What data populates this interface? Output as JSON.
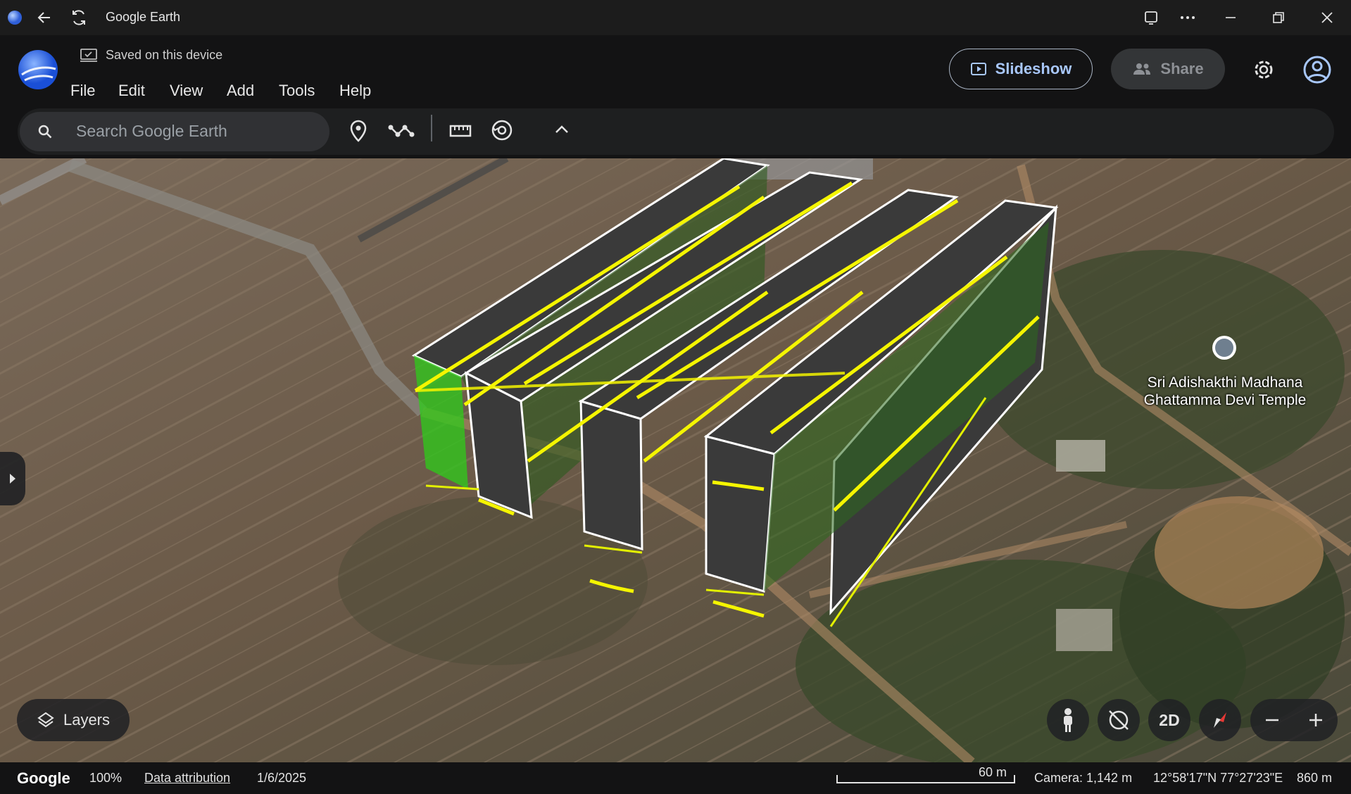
{
  "titlebar": {
    "title": "Google Earth"
  },
  "header": {
    "saved_label": "Saved on this device",
    "menu": [
      "File",
      "Edit",
      "View",
      "Add",
      "Tools",
      "Help"
    ],
    "slideshow_label": "Slideshow",
    "share_label": "Share"
  },
  "toolbar": {
    "search_placeholder": "Search Google Earth"
  },
  "map": {
    "place_label_line1": "Sri Adishakthi Madhana",
    "place_label_line2": "Ghattamma Devi Temple",
    "layers_label": "Layers",
    "view_mode_label": "2D",
    "overlay_colors": {
      "wall": "#3a3a3a",
      "edge": "#ffffff",
      "path": "#f5f500",
      "fill": "#2ecc1a"
    }
  },
  "statusbar": {
    "logo": "Google",
    "zoom": "100%",
    "attribution": "Data attribution",
    "date": "1/6/2025",
    "scale": "60 m",
    "camera": "Camera: 1,142 m",
    "coords": "12°58'17\"N 77°27'23\"E",
    "elevation": "860 m"
  },
  "colors": {
    "accent": "#a8c7fa",
    "background": "#131314"
  }
}
